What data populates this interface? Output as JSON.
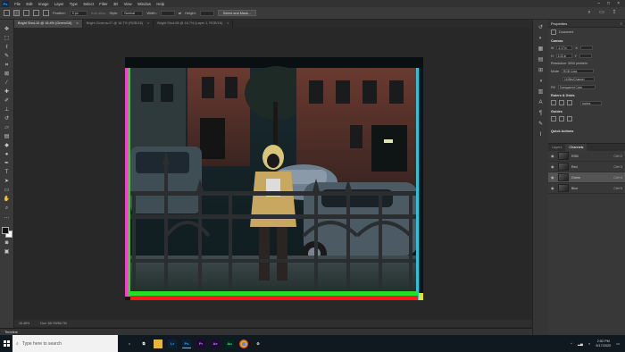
{
  "menubar": {
    "logo": "Ps",
    "items": [
      "File",
      "Edit",
      "Image",
      "Layer",
      "Type",
      "Select",
      "Filter",
      "3D",
      "View",
      "Window",
      "Help"
    ]
  },
  "options": {
    "feather_label": "Feather:",
    "feather_value": "0 px",
    "antialias_label": "Anti-alias",
    "style_label": "Style:",
    "style_value": "Normal",
    "width_label": "Width:",
    "height_label": "Height:",
    "select_mask_label": "Select and Mask..."
  },
  "tabs": [
    {
      "label": "Bright Shot-10 @ 16.4% (Green/16)",
      "active": true
    },
    {
      "label": "Bright Cinema-07 @ 16.7% (RGB/16)",
      "active": false
    },
    {
      "label": "Bright Shot-08 @ 16.7% (Layer 1, RGB/16)",
      "active": false
    }
  ],
  "status": {
    "zoom": "16.46%",
    "doc_info": "Doc: 68.7M/68.7M"
  },
  "timeline_label": "Timeline",
  "properties": {
    "title": "Properties",
    "doc_label": "Document",
    "canvas_section": "Canvas",
    "w_label": "W",
    "w_value": "4.17 in",
    "h_label": "H",
    "h_value": "3.33 in",
    "x_label": "X",
    "y_label": "Y",
    "resolution": "Resolution: 3000 pixels/in",
    "mode_label": "Mode",
    "mode_value": "RGB Color",
    "depth_value": "16 Bits/Channel",
    "fill_label": "Fill",
    "fill_value": "Transparent Color",
    "rulers_section": "Rulers & Grids",
    "units_value": "Inches",
    "guides_section": "Guides",
    "quick_actions_section": "Quick Actions"
  },
  "channels": {
    "tabs": [
      {
        "label": "Layers",
        "active": false
      },
      {
        "label": "Channels",
        "active": true
      }
    ],
    "rows": [
      {
        "name": "RGB",
        "key": "Ctrl+2",
        "selected": false
      },
      {
        "name": "Red",
        "key": "Ctrl+3",
        "selected": false
      },
      {
        "name": "Green",
        "key": "Ctrl+4",
        "selected": true
      },
      {
        "name": "Blue",
        "key": "Ctrl+5",
        "selected": false
      }
    ]
  },
  "taskbar": {
    "search_placeholder": "Type here to search",
    "time": "2:52 PM",
    "date": "5/17/2020"
  },
  "colors": {
    "accent": "#31a8ff",
    "selected_row": "#545454",
    "border_red": "#ff1a1a",
    "border_green": "#22e022"
  }
}
